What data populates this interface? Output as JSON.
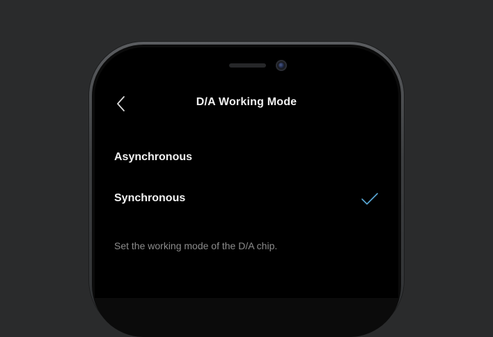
{
  "header": {
    "title": "D/A Working Mode",
    "back_icon": "chevron-left-icon"
  },
  "options": [
    {
      "label": "Asynchronous",
      "selected": false
    },
    {
      "label": "Synchronous",
      "selected": true
    }
  ],
  "check_icon": "checkmark-icon",
  "description": "Set the working mode of the D/A chip.",
  "colors": {
    "background": "#2a2b2c",
    "screen": "#000000",
    "text_primary": "#f2f2f2",
    "text_secondary": "#8c8c8c",
    "accent": "#5aa9d6"
  }
}
